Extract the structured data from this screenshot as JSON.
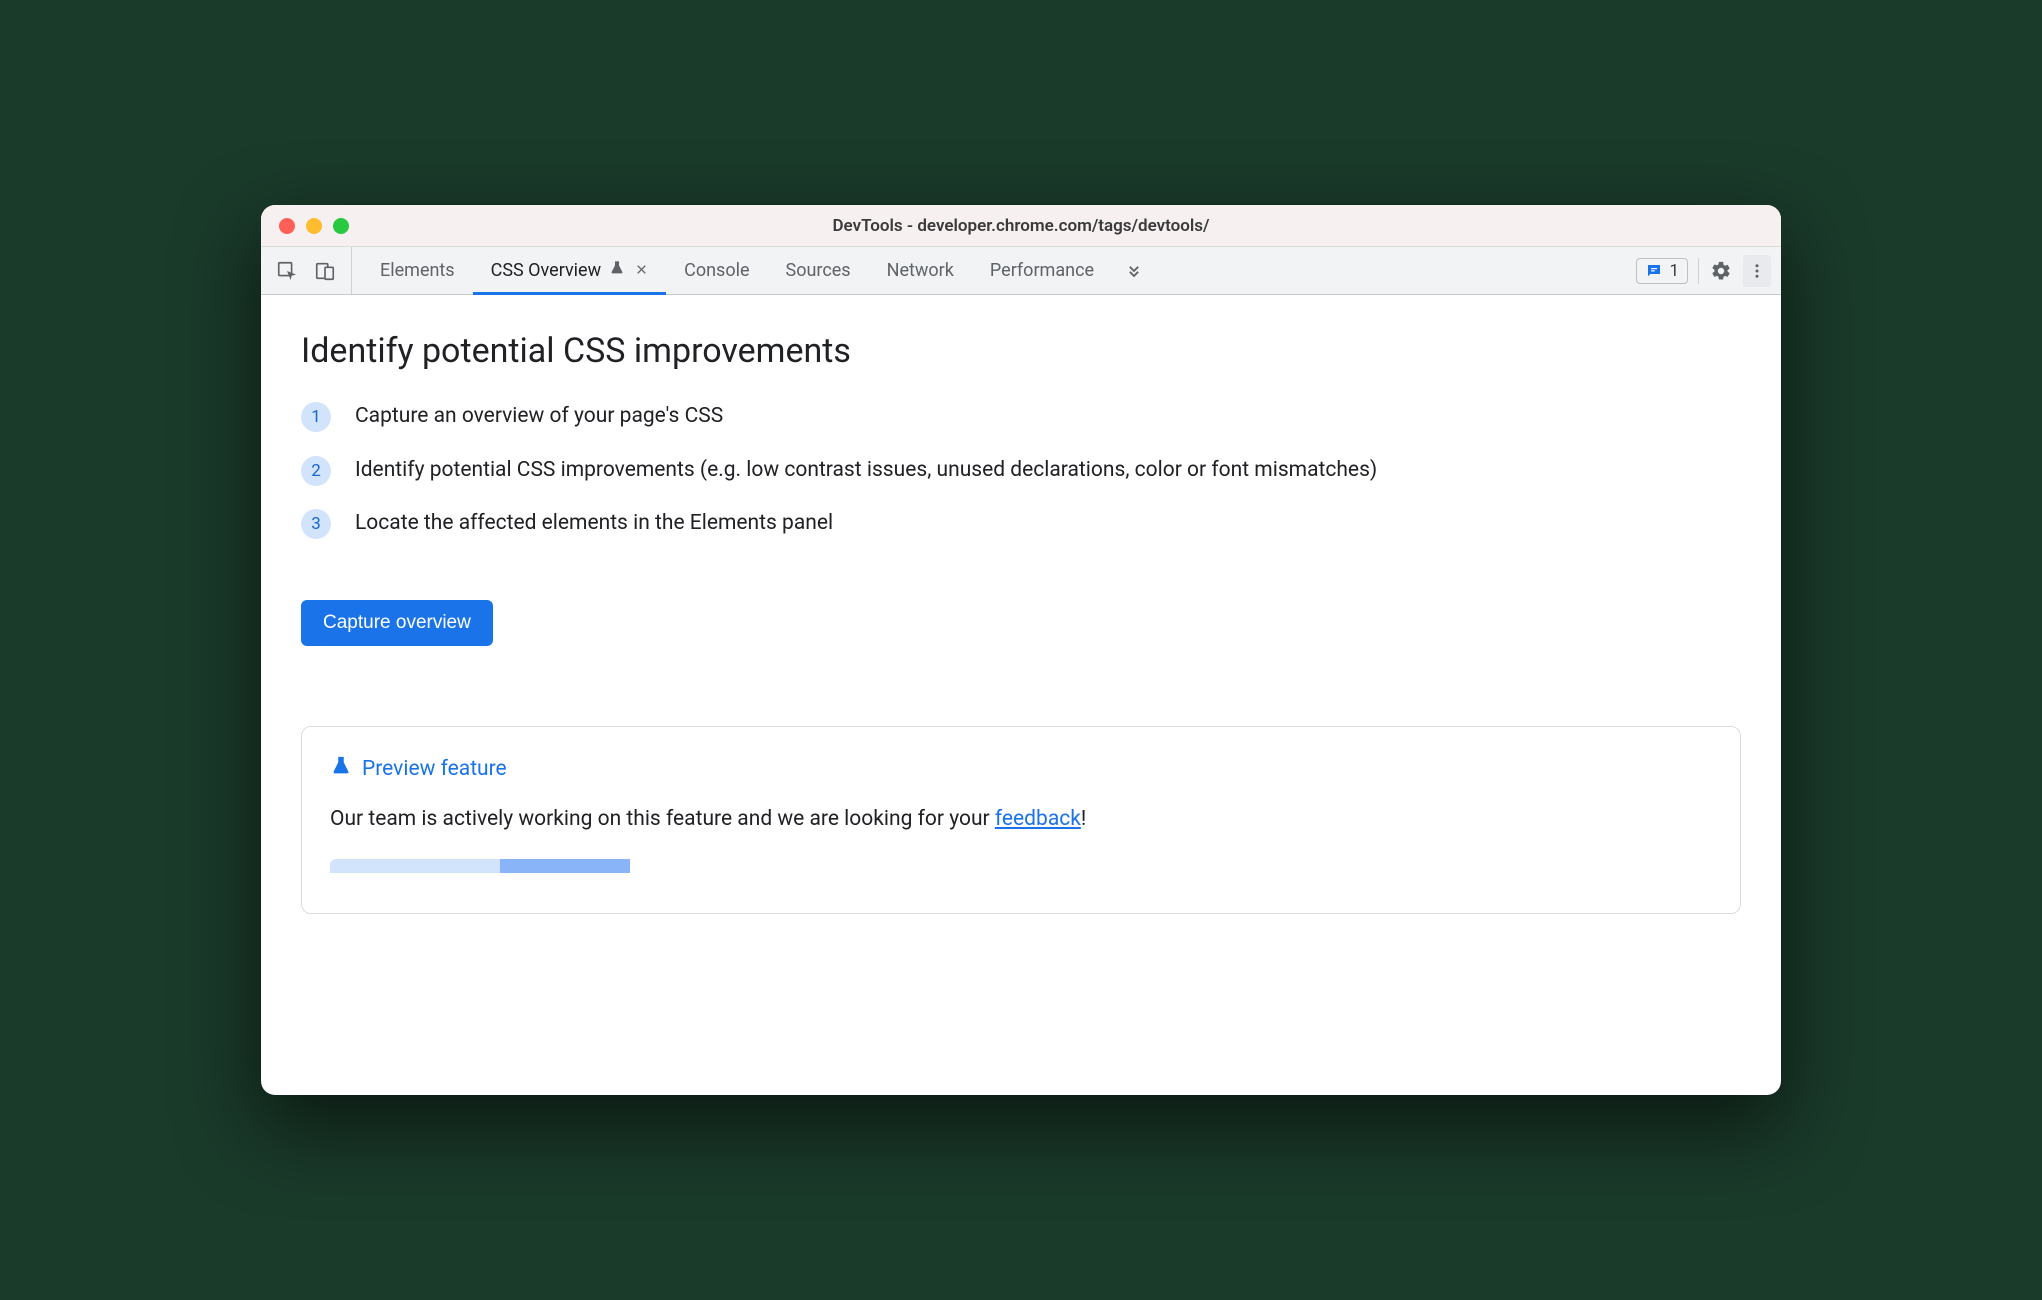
{
  "window": {
    "title": "DevTools - developer.chrome.com/tags/devtools/"
  },
  "tabs": {
    "items": [
      {
        "label": "Elements"
      },
      {
        "label": "CSS Overview"
      },
      {
        "label": "Console"
      },
      {
        "label": "Sources"
      },
      {
        "label": "Network"
      },
      {
        "label": "Performance"
      }
    ]
  },
  "issues": {
    "count": "1"
  },
  "main": {
    "heading": "Identify potential CSS improvements",
    "steps": [
      {
        "n": "1",
        "text": "Capture an overview of your page's CSS"
      },
      {
        "n": "2",
        "text": "Identify potential CSS improvements (e.g. low contrast issues, unused declarations, color or font mismatches)"
      },
      {
        "n": "3",
        "text": "Locate the affected elements in the Elements panel"
      }
    ],
    "capture_label": "Capture overview"
  },
  "preview": {
    "title": "Preview feature",
    "body_pre": "Our team is actively working on this feature and we are looking for your ",
    "link": "feedback",
    "body_post": "!"
  }
}
